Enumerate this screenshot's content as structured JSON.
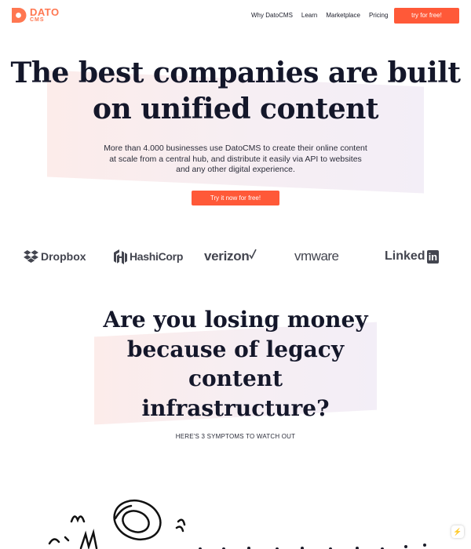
{
  "nav": {
    "logo_top": "DATO",
    "logo_bottom": "CMS",
    "links": [
      "Why DatoCMS",
      "Learn",
      "Marketplace",
      "Pricing"
    ],
    "cta": "try for free!"
  },
  "hero": {
    "title_line1": "The best companies are built",
    "title_line2": "on unified content",
    "subtitle": "More than 4.000 businesses use DatoCMS to create their online content at scale from a central hub, and distribute it easily via API to websites and any other digital experience.",
    "cta": "Try it now for free!"
  },
  "logos": {
    "dropbox": "Dropbox",
    "hashicorp": "HashiCorp",
    "verizon": "verizon",
    "vmware": "vmware",
    "linkedin_text": "Linked",
    "linkedin_box": "in"
  },
  "section2": {
    "title_lines": [
      "Are you losing money",
      "because of legacy",
      "content",
      "infrastructure?"
    ],
    "subtitle": "HERE'S 3 SYMPTOMS TO WATCH OUT"
  },
  "colors": {
    "accent": "#ff5938",
    "brand": "#ff7751",
    "text": "#14172a"
  },
  "icons": {
    "logo": "datocms-logo-icon",
    "dropbox": "dropbox-icon",
    "hashicorp": "hashicorp-icon",
    "verizon": "verizon-check-icon",
    "floating": "lightning-icon"
  }
}
